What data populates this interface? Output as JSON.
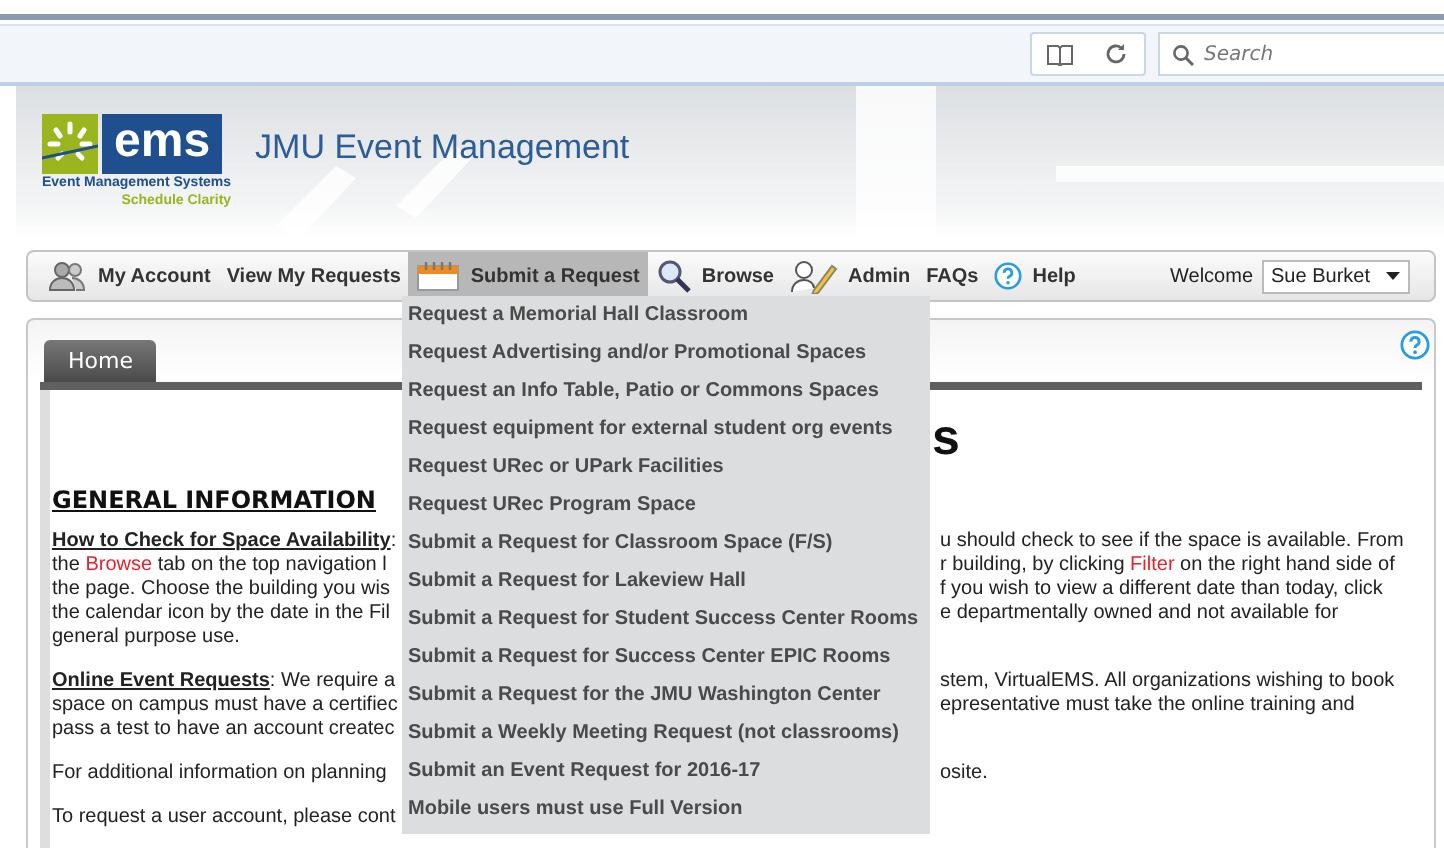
{
  "browser": {
    "search": {
      "placeholder": "Search"
    }
  },
  "header": {
    "logo": {
      "mark": "ems",
      "line1": "Event Management Systems",
      "line2": "Schedule Clarity"
    },
    "title": "JMU Event Management"
  },
  "nav": {
    "items": [
      {
        "label": "My Account",
        "selected": false
      },
      {
        "label": "View My Requests",
        "selected": false
      },
      {
        "label": "Submit a Request",
        "selected": true
      },
      {
        "label": "Browse",
        "selected": false
      },
      {
        "label": "Admin",
        "selected": false
      },
      {
        "label": "FAQs",
        "selected": false
      },
      {
        "label": "Help",
        "selected": false
      }
    ],
    "welcome": "Welcome",
    "user": "Sue Burket"
  },
  "dropdown": {
    "items": [
      "Request a Memorial Hall Classroom",
      "Request Advertising and/or Promotional Spaces",
      "Request an Info Table, Patio or Commons Spaces",
      "Request equipment for external student org events",
      "Request URec or UPark Facilities",
      "Request URec Program Space",
      "Submit a Request for Classroom Space (F/S)",
      "Submit a Request for Lakeview Hall",
      "Submit a Request for Student Success Center Rooms",
      "Submit a Request for Success Center EPIC Rooms",
      "Submit a Request for the JMU Washington Center",
      "Submit a Weekly Meeting Request (not classrooms)",
      "Submit an Event Request for 2016-17",
      "Mobile users must use Full Version"
    ]
  },
  "content": {
    "tabs": [
      {
        "label": "Home",
        "selected": true
      }
    ],
    "page_title": "s",
    "heading": "GENERAL INFORMATION",
    "lines": [
      {
        "gap": false,
        "left": [
          {
            "kind": "term",
            "text": "How to Check for Space Availability"
          },
          {
            "kind": "plain",
            "text": ":"
          }
        ],
        "right": [
          {
            "kind": "plain",
            "text": "u should check to see if the space is available. From"
          }
        ]
      },
      {
        "gap": false,
        "left": [
          {
            "kind": "plain",
            "text": "the "
          },
          {
            "kind": "link",
            "text": "Browse"
          },
          {
            "kind": "plain",
            "text": " tab on the top navigation l"
          }
        ],
        "right": [
          {
            "kind": "plain",
            "text": "r building, by clicking "
          },
          {
            "kind": "link",
            "text": "Filter"
          },
          {
            "kind": "plain",
            "text": " on the right hand side of"
          }
        ]
      },
      {
        "gap": false,
        "left": [
          {
            "kind": "plain",
            "text": "the page. Choose the building you wis"
          }
        ],
        "right": [
          {
            "kind": "plain",
            "text": "f you wish to view a different date than today, click"
          }
        ]
      },
      {
        "gap": false,
        "left": [
          {
            "kind": "plain",
            "text": "the calendar icon by the date in the Fil"
          }
        ],
        "right": [
          {
            "kind": "plain",
            "text": "e departmentally owned and not available for"
          }
        ]
      },
      {
        "gap": false,
        "left": [
          {
            "kind": "plain",
            "text": "general purpose use."
          }
        ]
      },
      {
        "gap": true,
        "left": [
          {
            "kind": "term",
            "text": "Online Event Requests"
          },
          {
            "kind": "plain",
            "text": ":  We require a"
          }
        ],
        "right": [
          {
            "kind": "plain",
            "text": "stem, VirtualEMS. All organizations wishing to book"
          }
        ]
      },
      {
        "gap": false,
        "left": [
          {
            "kind": "plain",
            "text": "space on campus must have a certifiec"
          }
        ],
        "right": [
          {
            "kind": "plain",
            "text": "epresentative must take the online training and"
          }
        ]
      },
      {
        "gap": false,
        "left": [
          {
            "kind": "plain",
            "text": "pass a test to have an account createc"
          }
        ]
      },
      {
        "gap": true,
        "left": [
          {
            "kind": "plain",
            "text": "For additional information on planning"
          }
        ],
        "right": [
          {
            "kind": "plain",
            "text": "osite."
          }
        ]
      },
      {
        "gap": true,
        "left": [
          {
            "kind": "plain",
            "text": "To request a user account, please cont"
          }
        ]
      }
    ]
  }
}
